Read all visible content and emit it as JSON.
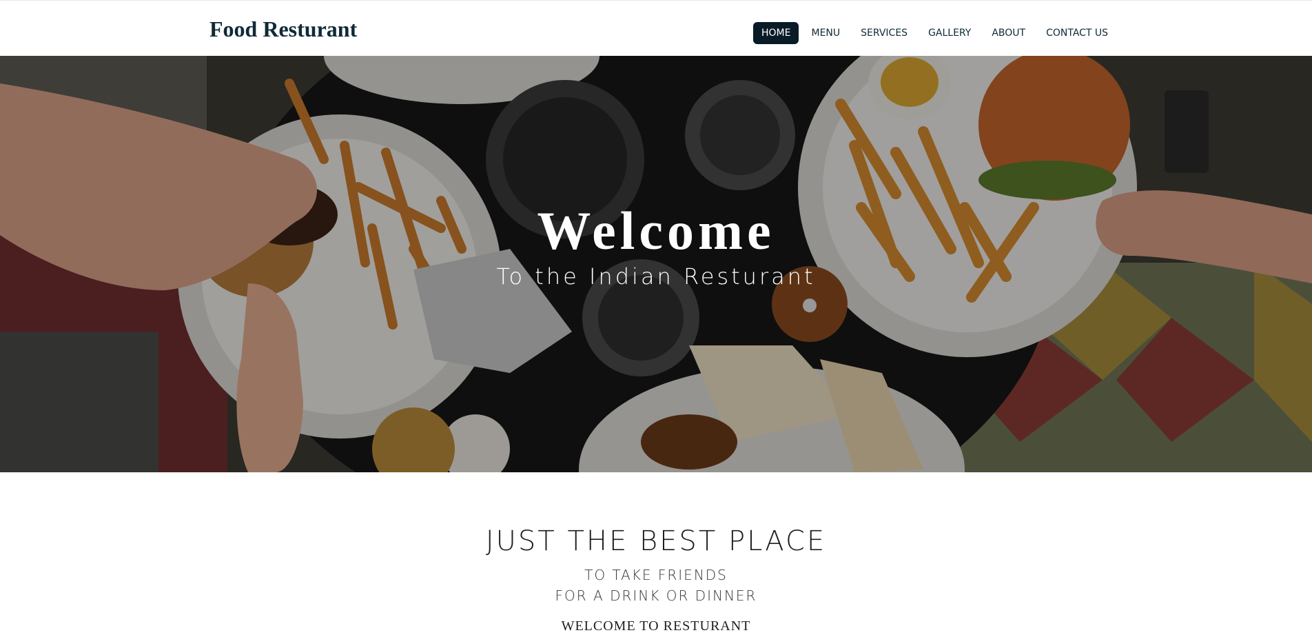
{
  "brand": {
    "name": "Food Resturant"
  },
  "nav": {
    "items": [
      {
        "label": "HOME",
        "active": true
      },
      {
        "label": "MENU",
        "active": false
      },
      {
        "label": "SERVICES",
        "active": false
      },
      {
        "label": "GALLERY",
        "active": false
      },
      {
        "label": "ABOUT",
        "active": false
      },
      {
        "label": "CONTACT US",
        "active": false
      }
    ]
  },
  "hero": {
    "title": "Welcome",
    "subtitle": "To the Indian Resturant",
    "image_icon": "food-table-photo"
  },
  "intro": {
    "heading": "JUST THE BEST PLACE",
    "line1": "TO TAKE FRIENDS",
    "line2": "FOR A DRINK OR DINNER",
    "welcome": "WELCOME TO RESTURANT"
  },
  "colors": {
    "nav_active_bg": "#081b27",
    "brand_text": "#0f2a36",
    "hero_overlay": "#000000"
  }
}
